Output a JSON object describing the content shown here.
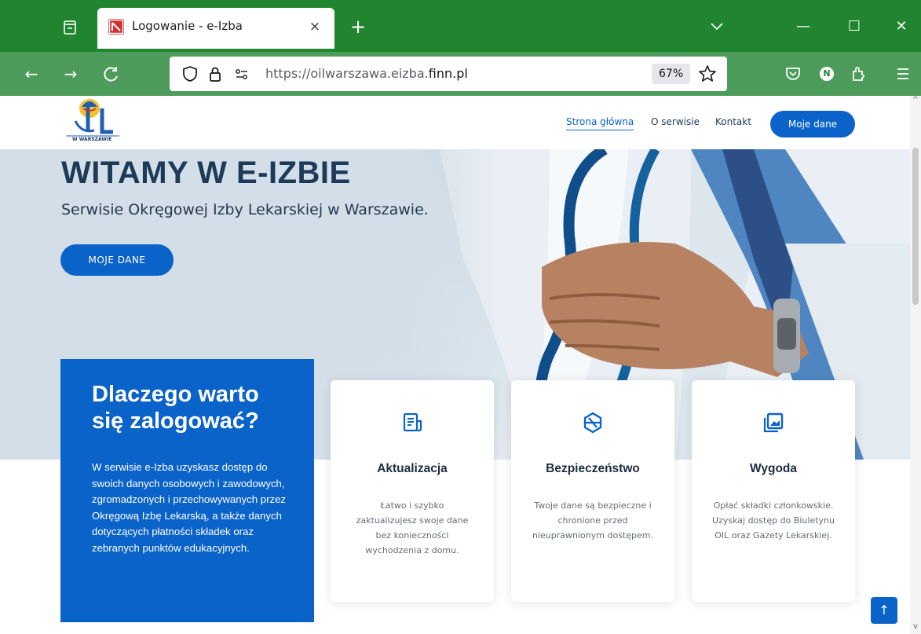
{
  "browser": {
    "tab_title": "Logowanie - e-Izba",
    "tab_close": "×",
    "new_tab": "+",
    "url_prefix": "https://oilwarszawa.eizba.",
    "url_domain": "finn.pl",
    "zoom": "67%",
    "profile_initial": "N",
    "window_minimize": "—",
    "window_maximize": "☐",
    "window_close": "✕"
  },
  "site": {
    "logo_text": "W WARSZAWIE",
    "nav": [
      {
        "label": "Strona główna"
      },
      {
        "label": "O serwisie"
      },
      {
        "label": "Kontakt"
      }
    ],
    "nav_cta": "Moje dane"
  },
  "hero": {
    "title": "WITAMY W E-IZBIE",
    "subtitle": "Serwisie Okręgowej Izby Lekarskiej w Warszawie.",
    "button": "MOJE DANE"
  },
  "why": {
    "title": "Dlaczego warto się zalogować?",
    "text": "W serwisie e-Izba uzyskasz dostęp do swoich danych osobowych i zawodowych, zgromadzonych i przechowywanych przez Okręgową Izbę Lekarską, a także danych dotyczących płatności składek oraz zebranych punktów edukacyjnych."
  },
  "cards": [
    {
      "icon": "document-icon",
      "title": "Aktualizacja",
      "text": "Łatwo i szybko zaktualizujesz swoje dane bez konieczności wychodzenia z domu."
    },
    {
      "icon": "shield-hexagon-icon",
      "title": "Bezpieczeństwo",
      "text": "Twoje dane są bezpieczne i chronione przed nieuprawnionym dostępem."
    },
    {
      "icon": "image-frame-icon",
      "title": "Wygoda",
      "text": "Opłać składki członkowskie. Uzyskaj dostęp do Biuletynu OIL oraz Gazety Lekarskiej."
    }
  ],
  "back_to_top": "↑",
  "colors": {
    "chrome_tabbar": "#21852f",
    "chrome_navbar": "#4e9c5b",
    "accent_blue": "#0a63c9",
    "heading_navy": "#1d3b58"
  }
}
